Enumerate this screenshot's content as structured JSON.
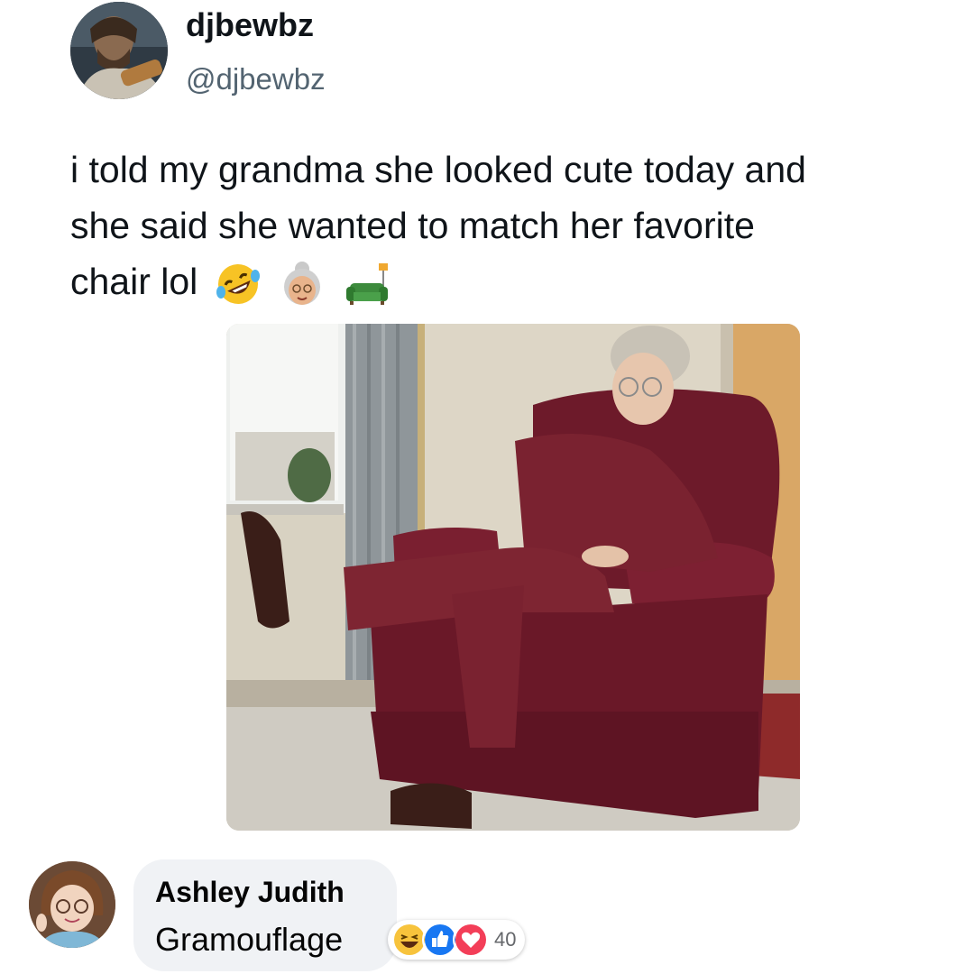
{
  "tweet": {
    "display_name": "djbewbz",
    "handle": "@djbewbz",
    "text_lines": [
      "i told my grandma she looked cute today and",
      "she said she wanted to match her favorite",
      "chair lol"
    ],
    "emojis": [
      "rolling-on-floor-laughing-icon",
      "older-woman-icon",
      "couch-icon"
    ]
  },
  "comment": {
    "author": "Ashley Judith",
    "text": "Gramouflage",
    "reactions": [
      "haha-reaction-icon",
      "like-reaction-icon",
      "love-reaction-icon"
    ],
    "reaction_count": "40"
  }
}
